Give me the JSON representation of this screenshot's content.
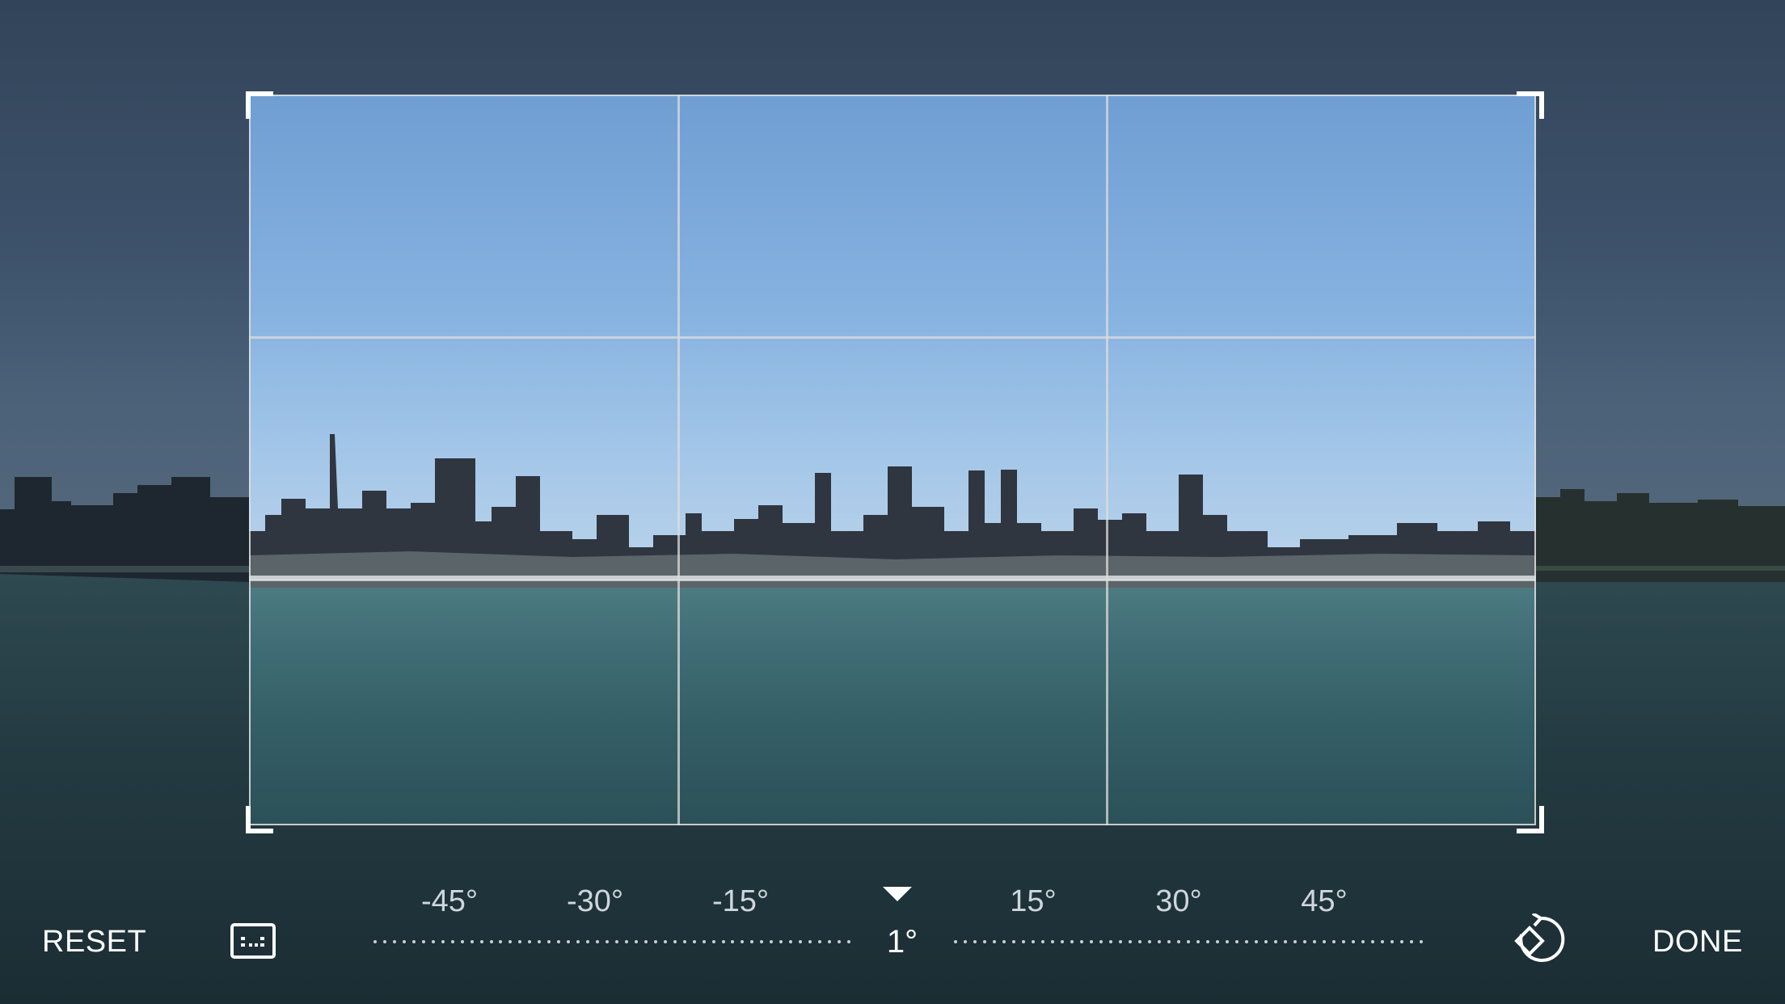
{
  "toolbar": {
    "reset_label": "RESET",
    "done_label": "DONE",
    "aspect_icon": "aspect-ratio-icon",
    "rotate_icon": "rotate-icon"
  },
  "straighten": {
    "ticks": [
      "-45°",
      "-30°",
      "-15°",
      "15°",
      "30°",
      "45°"
    ],
    "current_angle": "1°",
    "current_angle_degrees": 1,
    "range_degrees": [
      -45,
      45
    ]
  },
  "crop": {
    "grid": "rule-of-thirds"
  },
  "colors": {
    "accent": "#ffffff",
    "frame": "#e1e1e1"
  }
}
